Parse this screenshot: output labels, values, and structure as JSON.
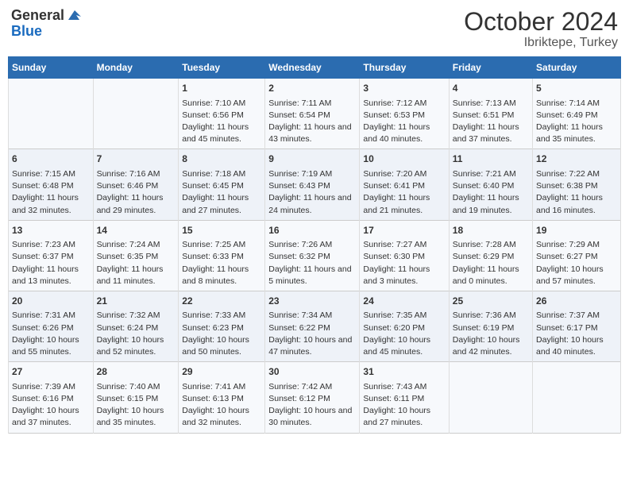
{
  "logo": {
    "text_general": "General",
    "text_blue": "Blue"
  },
  "header": {
    "month": "October 2024",
    "location": "Ibriktepe, Turkey"
  },
  "weekdays": [
    "Sunday",
    "Monday",
    "Tuesday",
    "Wednesday",
    "Thursday",
    "Friday",
    "Saturday"
  ],
  "weeks": [
    [
      {
        "day": "",
        "info": ""
      },
      {
        "day": "",
        "info": ""
      },
      {
        "day": "1",
        "info": "Sunrise: 7:10 AM\nSunset: 6:56 PM\nDaylight: 11 hours and 45 minutes."
      },
      {
        "day": "2",
        "info": "Sunrise: 7:11 AM\nSunset: 6:54 PM\nDaylight: 11 hours and 43 minutes."
      },
      {
        "day": "3",
        "info": "Sunrise: 7:12 AM\nSunset: 6:53 PM\nDaylight: 11 hours and 40 minutes."
      },
      {
        "day": "4",
        "info": "Sunrise: 7:13 AM\nSunset: 6:51 PM\nDaylight: 11 hours and 37 minutes."
      },
      {
        "day": "5",
        "info": "Sunrise: 7:14 AM\nSunset: 6:49 PM\nDaylight: 11 hours and 35 minutes."
      }
    ],
    [
      {
        "day": "6",
        "info": "Sunrise: 7:15 AM\nSunset: 6:48 PM\nDaylight: 11 hours and 32 minutes."
      },
      {
        "day": "7",
        "info": "Sunrise: 7:16 AM\nSunset: 6:46 PM\nDaylight: 11 hours and 29 minutes."
      },
      {
        "day": "8",
        "info": "Sunrise: 7:18 AM\nSunset: 6:45 PM\nDaylight: 11 hours and 27 minutes."
      },
      {
        "day": "9",
        "info": "Sunrise: 7:19 AM\nSunset: 6:43 PM\nDaylight: 11 hours and 24 minutes."
      },
      {
        "day": "10",
        "info": "Sunrise: 7:20 AM\nSunset: 6:41 PM\nDaylight: 11 hours and 21 minutes."
      },
      {
        "day": "11",
        "info": "Sunrise: 7:21 AM\nSunset: 6:40 PM\nDaylight: 11 hours and 19 minutes."
      },
      {
        "day": "12",
        "info": "Sunrise: 7:22 AM\nSunset: 6:38 PM\nDaylight: 11 hours and 16 minutes."
      }
    ],
    [
      {
        "day": "13",
        "info": "Sunrise: 7:23 AM\nSunset: 6:37 PM\nDaylight: 11 hours and 13 minutes."
      },
      {
        "day": "14",
        "info": "Sunrise: 7:24 AM\nSunset: 6:35 PM\nDaylight: 11 hours and 11 minutes."
      },
      {
        "day": "15",
        "info": "Sunrise: 7:25 AM\nSunset: 6:33 PM\nDaylight: 11 hours and 8 minutes."
      },
      {
        "day": "16",
        "info": "Sunrise: 7:26 AM\nSunset: 6:32 PM\nDaylight: 11 hours and 5 minutes."
      },
      {
        "day": "17",
        "info": "Sunrise: 7:27 AM\nSunset: 6:30 PM\nDaylight: 11 hours and 3 minutes."
      },
      {
        "day": "18",
        "info": "Sunrise: 7:28 AM\nSunset: 6:29 PM\nDaylight: 11 hours and 0 minutes."
      },
      {
        "day": "19",
        "info": "Sunrise: 7:29 AM\nSunset: 6:27 PM\nDaylight: 10 hours and 57 minutes."
      }
    ],
    [
      {
        "day": "20",
        "info": "Sunrise: 7:31 AM\nSunset: 6:26 PM\nDaylight: 10 hours and 55 minutes."
      },
      {
        "day": "21",
        "info": "Sunrise: 7:32 AM\nSunset: 6:24 PM\nDaylight: 10 hours and 52 minutes."
      },
      {
        "day": "22",
        "info": "Sunrise: 7:33 AM\nSunset: 6:23 PM\nDaylight: 10 hours and 50 minutes."
      },
      {
        "day": "23",
        "info": "Sunrise: 7:34 AM\nSunset: 6:22 PM\nDaylight: 10 hours and 47 minutes."
      },
      {
        "day": "24",
        "info": "Sunrise: 7:35 AM\nSunset: 6:20 PM\nDaylight: 10 hours and 45 minutes."
      },
      {
        "day": "25",
        "info": "Sunrise: 7:36 AM\nSunset: 6:19 PM\nDaylight: 10 hours and 42 minutes."
      },
      {
        "day": "26",
        "info": "Sunrise: 7:37 AM\nSunset: 6:17 PM\nDaylight: 10 hours and 40 minutes."
      }
    ],
    [
      {
        "day": "27",
        "info": "Sunrise: 7:39 AM\nSunset: 6:16 PM\nDaylight: 10 hours and 37 minutes."
      },
      {
        "day": "28",
        "info": "Sunrise: 7:40 AM\nSunset: 6:15 PM\nDaylight: 10 hours and 35 minutes."
      },
      {
        "day": "29",
        "info": "Sunrise: 7:41 AM\nSunset: 6:13 PM\nDaylight: 10 hours and 32 minutes."
      },
      {
        "day": "30",
        "info": "Sunrise: 7:42 AM\nSunset: 6:12 PM\nDaylight: 10 hours and 30 minutes."
      },
      {
        "day": "31",
        "info": "Sunrise: 7:43 AM\nSunset: 6:11 PM\nDaylight: 10 hours and 27 minutes."
      },
      {
        "day": "",
        "info": ""
      },
      {
        "day": "",
        "info": ""
      }
    ]
  ]
}
